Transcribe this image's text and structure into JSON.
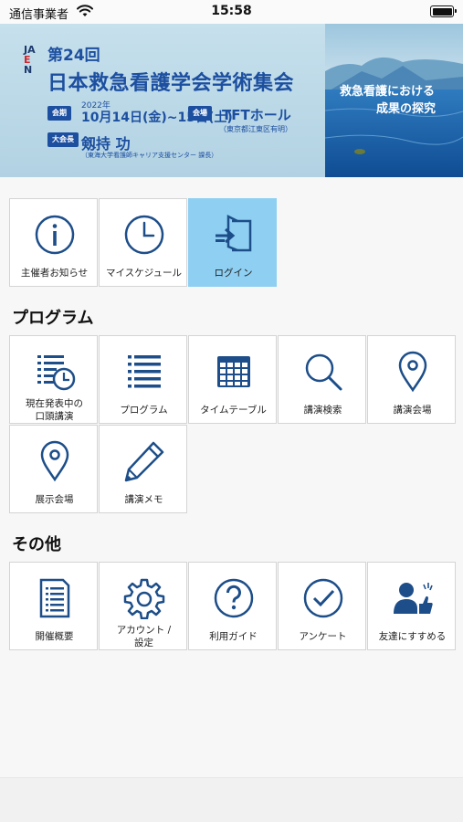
{
  "status_bar": {
    "carrier": "通信事業者",
    "time": "15:58"
  },
  "banner": {
    "logo_letters": [
      "JA",
      "E",
      "N"
    ],
    "congress_no": "第24回",
    "congress_title": "日本救急看護学会学術集会",
    "date_tag": "会期",
    "year": "2022年",
    "dates": "10月14日(金)~15日(土)",
    "venue_tag": "会場",
    "venue": "TFTホール",
    "venue_sub": "（東京都江東区有明）",
    "president_tag": "大会長",
    "president": "剱持 功",
    "president_sub": "（東海大学看護師キャリア支援センター 課長）",
    "theme_line1": "救急看護における",
    "theme_line2": "成果の探究"
  },
  "top_menu": [
    {
      "label": "主催者お知らせ",
      "icon": "info-icon"
    },
    {
      "label": "マイスケジュール",
      "icon": "clock-icon"
    },
    {
      "label": "ログイン",
      "icon": "login-icon",
      "active": true
    }
  ],
  "program_section": {
    "title": "プログラム",
    "items": [
      {
        "label_line1": "現在発表中の",
        "label_line2": "口頭講演",
        "icon": "list-clock-icon"
      },
      {
        "label": "プログラム",
        "icon": "list-icon"
      },
      {
        "label": "タイムテーブル",
        "icon": "calendar-icon"
      },
      {
        "label": "講演検索",
        "icon": "search-icon"
      },
      {
        "label": "講演会場",
        "icon": "location-pin-icon"
      },
      {
        "label": "展示会場",
        "icon": "location-pin-icon"
      },
      {
        "label": "講演メモ",
        "icon": "pencil-icon"
      }
    ]
  },
  "other_section": {
    "title": "その他",
    "items": [
      {
        "label": "開催概要",
        "icon": "document-icon"
      },
      {
        "label_line1": "アカウント /",
        "label_line2": "設定",
        "icon": "gear-icon"
      },
      {
        "label": "利用ガイド",
        "icon": "help-icon"
      },
      {
        "label": "アンケート",
        "icon": "check-circle-icon"
      },
      {
        "label": "友達にすすめる",
        "icon": "recommend-user-icon"
      }
    ]
  },
  "colors": {
    "accent": "#1d4e89",
    "active_tile": "#8ecff2",
    "banner_blue": "#1d4fa0"
  }
}
